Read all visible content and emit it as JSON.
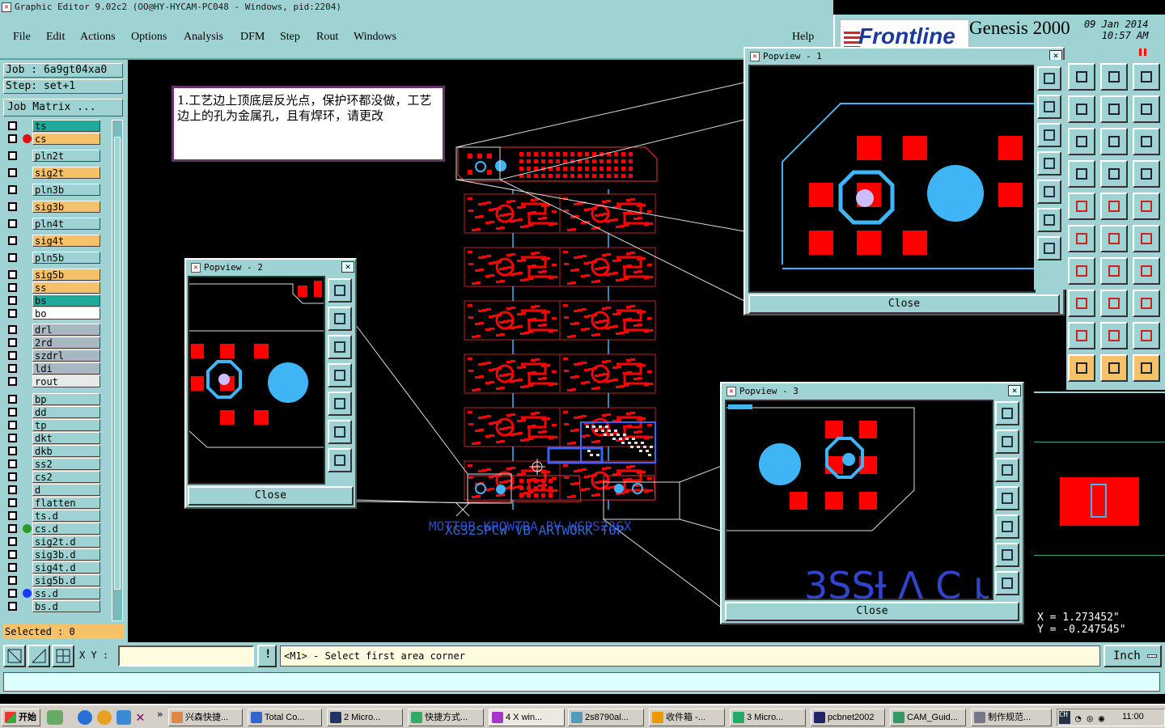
{
  "window": {
    "title": "Graphic Editor 9.02c2 (OO@HY-HYCAM-PC048 - Windows, pid:2204)"
  },
  "menu": {
    "items": [
      "File",
      "Edit",
      "Actions",
      "Options",
      "Analysis",
      "DFM",
      "Step",
      "Rout",
      "Windows"
    ],
    "help": "Help"
  },
  "brand": {
    "logo": "Frontline",
    "product": "Genesis 2000",
    "date": "09 Jan 2014",
    "time": "10:57 AM"
  },
  "job": {
    "job_label": "Job :",
    "job_name": "6a9gt04xa0",
    "step_label": "Step:",
    "step_name": "set+1",
    "matrix_button": "Job Matrix ..."
  },
  "layers": [
    {
      "name": "ts",
      "color": "#1fa99a",
      "dot": ""
    },
    {
      "name": "cs",
      "color": "#f5c26a",
      "dot": "#e01010"
    },
    {
      "name": "pln2t",
      "color": "#9fd3d3",
      "dot": ""
    },
    {
      "name": "sig2t",
      "color": "#f5c26a",
      "dot": ""
    },
    {
      "name": "pln3b",
      "color": "#9fd3d3",
      "dot": ""
    },
    {
      "name": "sig3b",
      "color": "#f5c26a",
      "dot": ""
    },
    {
      "name": "pln4t",
      "color": "#9fd3d3",
      "dot": ""
    },
    {
      "name": "sig4t",
      "color": "#f5c26a",
      "dot": ""
    },
    {
      "name": "pln5b",
      "color": "#9fd3d3",
      "dot": ""
    },
    {
      "name": "sig5b",
      "color": "#f5c26a",
      "dot": ""
    },
    {
      "name": "ss",
      "color": "#f5c26a",
      "dot": ""
    },
    {
      "name": "bs",
      "color": "#1fa99a",
      "dot": ""
    },
    {
      "name": "bo",
      "color": "#ffffff",
      "dot": ""
    },
    {
      "name": "drl",
      "color": "#a8b8c0",
      "dot": ""
    },
    {
      "name": "2rd",
      "color": "#a8b8c0",
      "dot": ""
    },
    {
      "name": "szdrl",
      "color": "#a8b8c0",
      "dot": ""
    },
    {
      "name": "ldi",
      "color": "#a8b8c0",
      "dot": ""
    },
    {
      "name": "rout",
      "color": "#e8e8e8",
      "dot": ""
    },
    {
      "name": "bp",
      "color": "#9fd3d3",
      "dot": ""
    },
    {
      "name": "dd",
      "color": "#9fd3d3",
      "dot": ""
    },
    {
      "name": "tp",
      "color": "#9fd3d3",
      "dot": ""
    },
    {
      "name": "dkt",
      "color": "#9fd3d3",
      "dot": ""
    },
    {
      "name": "dkb",
      "color": "#9fd3d3",
      "dot": ""
    },
    {
      "name": "ss2",
      "color": "#9fd3d3",
      "dot": ""
    },
    {
      "name": "cs2",
      "color": "#9fd3d3",
      "dot": ""
    },
    {
      "name": "d",
      "color": "#9fd3d3",
      "dot": ""
    },
    {
      "name": "flatten",
      "color": "#9fd3d3",
      "dot": ""
    },
    {
      "name": "ts.d",
      "color": "#9fd3d3",
      "dot": ""
    },
    {
      "name": "cs.d",
      "color": "#9fd3d3",
      "dot": "#2a9a2a"
    },
    {
      "name": "sig2t.d",
      "color": "#9fd3d3",
      "dot": ""
    },
    {
      "name": "sig3b.d",
      "color": "#9fd3d3",
      "dot": ""
    },
    {
      "name": "sig4t.d",
      "color": "#9fd3d3",
      "dot": ""
    },
    {
      "name": "sig5b.d",
      "color": "#9fd3d3",
      "dot": ""
    },
    {
      "name": "ss.d",
      "color": "#9fd3d3",
      "dot": "#1a3aff"
    },
    {
      "name": "bs.d",
      "color": "#9fd3d3",
      "dot": ""
    }
  ],
  "selected": "Selected : 0",
  "status": {
    "xy_label": "X Y :",
    "xy_value": "",
    "prompt": "<M1> - Select first area corner",
    "units": "Inch"
  },
  "note": "1.工艺边上顶底层反光点，保护环都没做，工艺边上的孔为金属孔，且有焊环，请更改",
  "silk_text": {
    "top": "XG32SPCW VB ARTWORK TOP",
    "mirror": "MOTTOB KROWTRA BV WCPS23GX"
  },
  "popviews": [
    {
      "title": "Popview - 1",
      "close": "Close"
    },
    {
      "title": "Popview - 2",
      "close": "Close"
    },
    {
      "title": "Popview - 3",
      "close": "Close"
    }
  ],
  "coords": {
    "x": "X = 1.273452\"",
    "y": "Y = -0.247545\""
  },
  "taskbar": {
    "start": "开始",
    "items": [
      "兴森快捷...",
      "Total Co...",
      "2 Micro...",
      "快捷方式...",
      "4 X win...",
      "2s8790al...",
      "收件箱 -...",
      "3 Micro...",
      "pcbnet2002",
      "CAM_Guid...",
      "制作规范..."
    ],
    "clock": "11:00"
  },
  "colors": {
    "teal": "#9fd3d3",
    "pad_red": "#ff0000",
    "hole_blue": "#3fb5f5"
  }
}
